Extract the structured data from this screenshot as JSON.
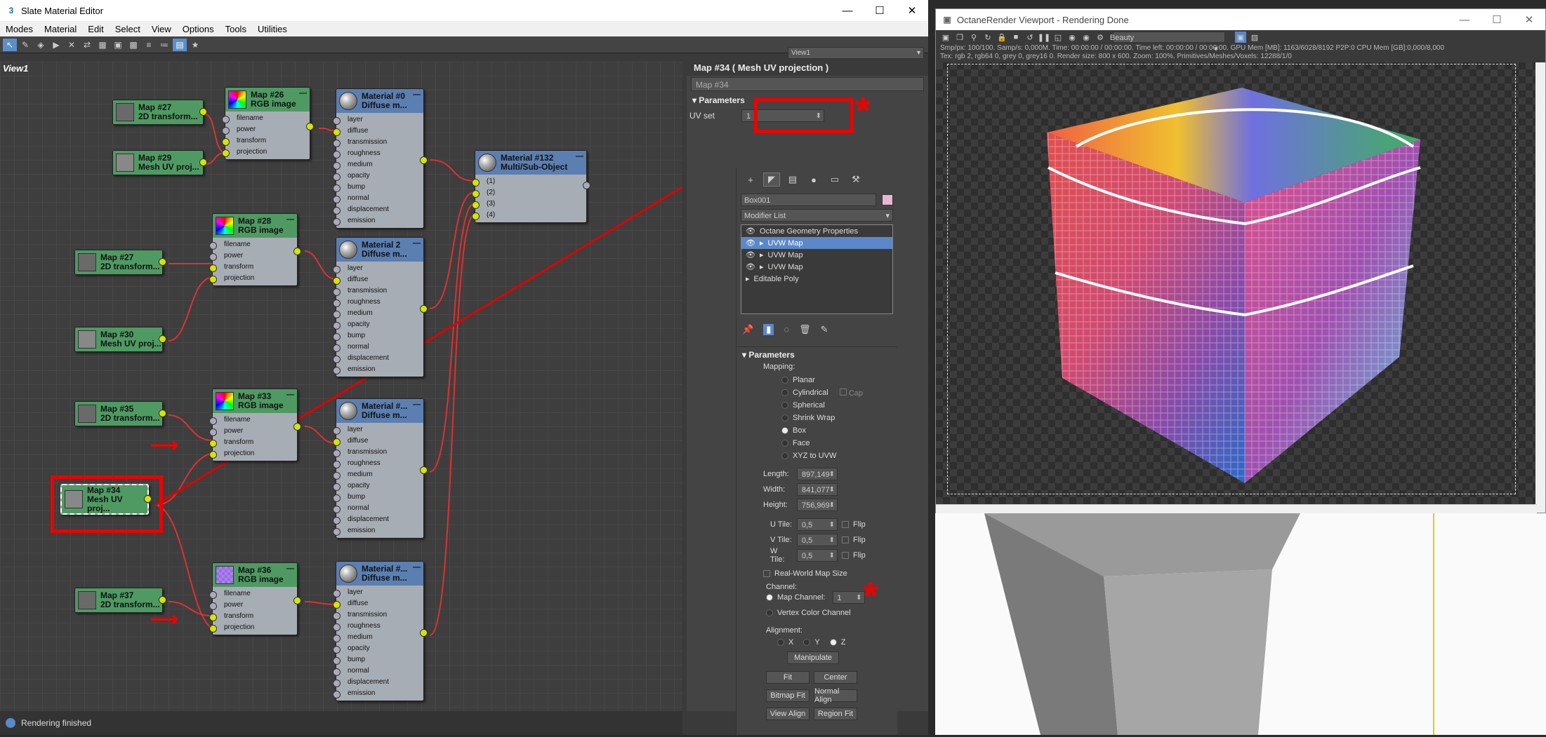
{
  "slate": {
    "title": "Slate Material Editor",
    "menu": [
      "Modes",
      "Material",
      "Edit",
      "Select",
      "View",
      "Options",
      "Tools",
      "Utilities"
    ],
    "view_dropdown": "View1",
    "view_tab": "View1",
    "status": "Rendering finished"
  },
  "nodes": {
    "map27a": {
      "name": "Map #27",
      "type": "2D transform..."
    },
    "map29": {
      "name": "Map #29",
      "type": "Mesh UV proj..."
    },
    "map26": {
      "name": "Map #26",
      "type": "RGB image"
    },
    "mat0": {
      "name": "Material #0",
      "type": "Diffuse m..."
    },
    "mat132": {
      "name": "Material #132",
      "type": "Multi/Sub-Object"
    },
    "map28": {
      "name": "Map #28",
      "type": "RGB image"
    },
    "map27b": {
      "name": "Map #27",
      "type": "2D transform..."
    },
    "map30": {
      "name": "Map #30",
      "type": "Mesh UV proj..."
    },
    "mat2": {
      "name": "Material 2",
      "type": "Diffuse m..."
    },
    "map35": {
      "name": "Map #35",
      "type": "2D transform..."
    },
    "map33": {
      "name": "Map #33",
      "type": "RGB image"
    },
    "mat3": {
      "name": "Material #...",
      "type": "Diffuse m..."
    },
    "map34": {
      "name": "Map #34",
      "type": "Mesh UV proj..."
    },
    "map37": {
      "name": "Map #37",
      "type": "2D transform..."
    },
    "map36": {
      "name": "Map #36",
      "type": "RGB image"
    },
    "mat4": {
      "name": "Material #...",
      "type": "Diffuse m..."
    }
  },
  "slots": {
    "rgb": [
      "filename",
      "power",
      "transform",
      "projection"
    ],
    "diffuse": [
      "layer",
      "diffuse",
      "transmission",
      "roughness",
      "medium",
      "opacity",
      "bump",
      "normal",
      "displacement",
      "emission"
    ],
    "multi": [
      "(1)",
      "(2)",
      "(3)",
      "(4)"
    ]
  },
  "params": {
    "title": "Map #34  ( Mesh UV projection )",
    "name_field": "Map #34",
    "rollout": "Parameters",
    "uv_set_label": "UV set",
    "uv_set_value": "1"
  },
  "command": {
    "object_name": "Box001",
    "modifier_list": "Modifier List",
    "stack": [
      "Octane Geometry Properties",
      "UVW Map",
      "UVW Map",
      "UVW Map",
      "Editable Poly"
    ],
    "rollout": "Parameters",
    "mapping_label": "Mapping:",
    "mapping_options": [
      "Planar",
      "Cylindrical",
      "Spherical",
      "Shrink Wrap",
      "Box",
      "Face",
      "XYZ to UVW"
    ],
    "cap_label": "Cap",
    "length_label": "Length:",
    "length": "897,149",
    "width_label": "Width:",
    "width": "841,077",
    "height_label": "Height:",
    "height": "756,969",
    "utile_label": "U Tile:",
    "utile": "0,5",
    "vtile_label": "V Tile:",
    "vtile": "0,5",
    "wtile_label": "W Tile:",
    "wtile": "0,5",
    "flip": "Flip",
    "realworld": "Real-World Map Size",
    "channel_label": "Channel:",
    "map_channel_label": "Map Channel:",
    "map_channel": "1",
    "vertex_color": "Vertex Color Channel",
    "alignment_label": "Alignment:",
    "axis_x": "X",
    "axis_y": "Y",
    "axis_z": "Z",
    "manipulate": "Manipulate",
    "fit": "Fit",
    "center": "Center",
    "bitmap_fit": "Bitmap Fit",
    "normal_align": "Normal Align",
    "view_align": "View Align",
    "region_fit": "Region Fit"
  },
  "octane": {
    "title": "OctaneRender Viewport - Rendering Done",
    "pass": "Beauty",
    "info1": "Smp/px: 100/100.   Samp/s: 0,000M.   Time: 00:00:00 / 00:00:00.   Time left: 00:00:00 / 00:00:00.   GPU Mem [MB]: 1163/6028/8192 P2P:0   CPU Mem [GB]:0,000/8,000",
    "info2": "Tex: rgb 2, rgb64 0, grey 0, grey16 0.   Render size: 800 x 600.   Zoom: 100%.   Primitives/Meshes/Voxels: 12288/1/0"
  },
  "colors": {
    "accent": "#5a88c8",
    "mark": "#e00000",
    "port": "#d4e600"
  }
}
